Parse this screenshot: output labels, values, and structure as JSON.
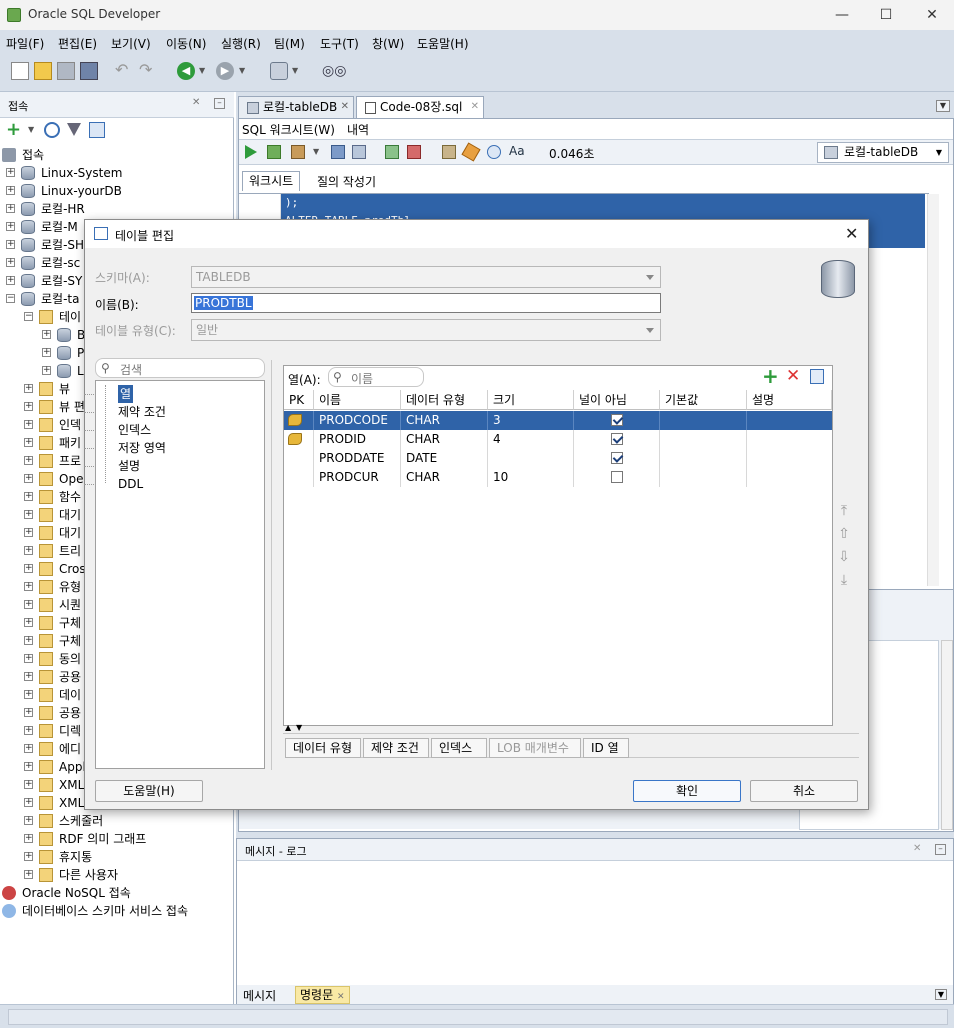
{
  "window": {
    "title": "Oracle SQL Developer",
    "minimize": "—",
    "maximize": "☐",
    "close": "✕"
  },
  "menu": [
    "파일(F)",
    "편집(E)",
    "보기(V)",
    "이동(N)",
    "실행(R)",
    "팀(M)",
    "도구(T)",
    "창(W)",
    "도움말(H)"
  ],
  "left_panel": {
    "title": "접속",
    "root": "접속",
    "connections": [
      "Linux-System",
      "Linux-yourDB",
      "로컬-HR",
      "로컬-M",
      "로컬-SH",
      "로컬-sc",
      "로컬-SY",
      "로컬-ta"
    ],
    "table_folder": "테이",
    "table_children": [
      "B",
      "P",
      "L"
    ],
    "object_types": [
      "뷰",
      "뷰 편",
      "인덱",
      "패키",
      "프로",
      "Ope",
      "함수",
      "대기",
      "대기",
      "트리",
      "Cros",
      "유형",
      "시퀀",
      "구체",
      "구체",
      "동의",
      "공용",
      "데이",
      "공용",
      "디렉",
      "에디",
      "Appl",
      "XML",
      "XML",
      "스케줄러",
      "RDF 의미 그래프",
      "휴지통",
      "다른 사용자"
    ],
    "bottom_items": [
      "Oracle NoSQL 접속",
      "데이터베이스 스키마 서비스 접속"
    ]
  },
  "editor": {
    "tabs": [
      {
        "label": "로컬-tableDB"
      },
      {
        "label": "Code-08장.sql"
      }
    ],
    "subtabs": [
      "SQL 워크시트(W)",
      "내역"
    ],
    "time": "0.046초",
    "connection_select": "로컬-tableDB",
    "worksheet_tabs": [
      "워크시트",
      "질의 작성기"
    ],
    "code_lines": [
      ");",
      "ALTER TABLE prodTbl"
    ]
  },
  "messages": {
    "title": "메시지 - 로그",
    "tabs": [
      "메시지",
      "명령문"
    ]
  },
  "dialog": {
    "title": "테이블 편집",
    "schema_label": "스키마(A):",
    "schema_value": "TABLEDB",
    "name_label": "이름(B):",
    "name_value": "PRODTBL",
    "type_label": "테이블 유형(C):",
    "type_value": "일반",
    "search_placeholder": "검색",
    "nav_items": [
      "열",
      "제약 조건",
      "인덱스",
      "저장 영역",
      "설명",
      "DDL"
    ],
    "columns_label": "열(A):",
    "columns_search_placeholder": "이름",
    "headers": [
      "PK",
      "이름",
      "데이터 유형",
      "크기",
      "널이 아님",
      "기본값",
      "설명"
    ],
    "rows": [
      {
        "pk": true,
        "name": "PRODCODE",
        "type": "CHAR",
        "size": "3",
        "not_null": true
      },
      {
        "pk": true,
        "name": "PRODID",
        "type": "CHAR",
        "size": "4",
        "not_null": true
      },
      {
        "pk": false,
        "name": "PRODDATE",
        "type": "DATE",
        "size": "",
        "not_null": true
      },
      {
        "pk": false,
        "name": "PRODCUR",
        "type": "CHAR",
        "size": "10",
        "not_null": false
      }
    ],
    "bottom_tabs": [
      "데이터 유형",
      "제약 조건",
      "인덱스",
      "LOB 매개변수",
      "ID 열"
    ],
    "help_button": "도움말(H)",
    "ok_button": "확인",
    "cancel_button": "취소"
  }
}
